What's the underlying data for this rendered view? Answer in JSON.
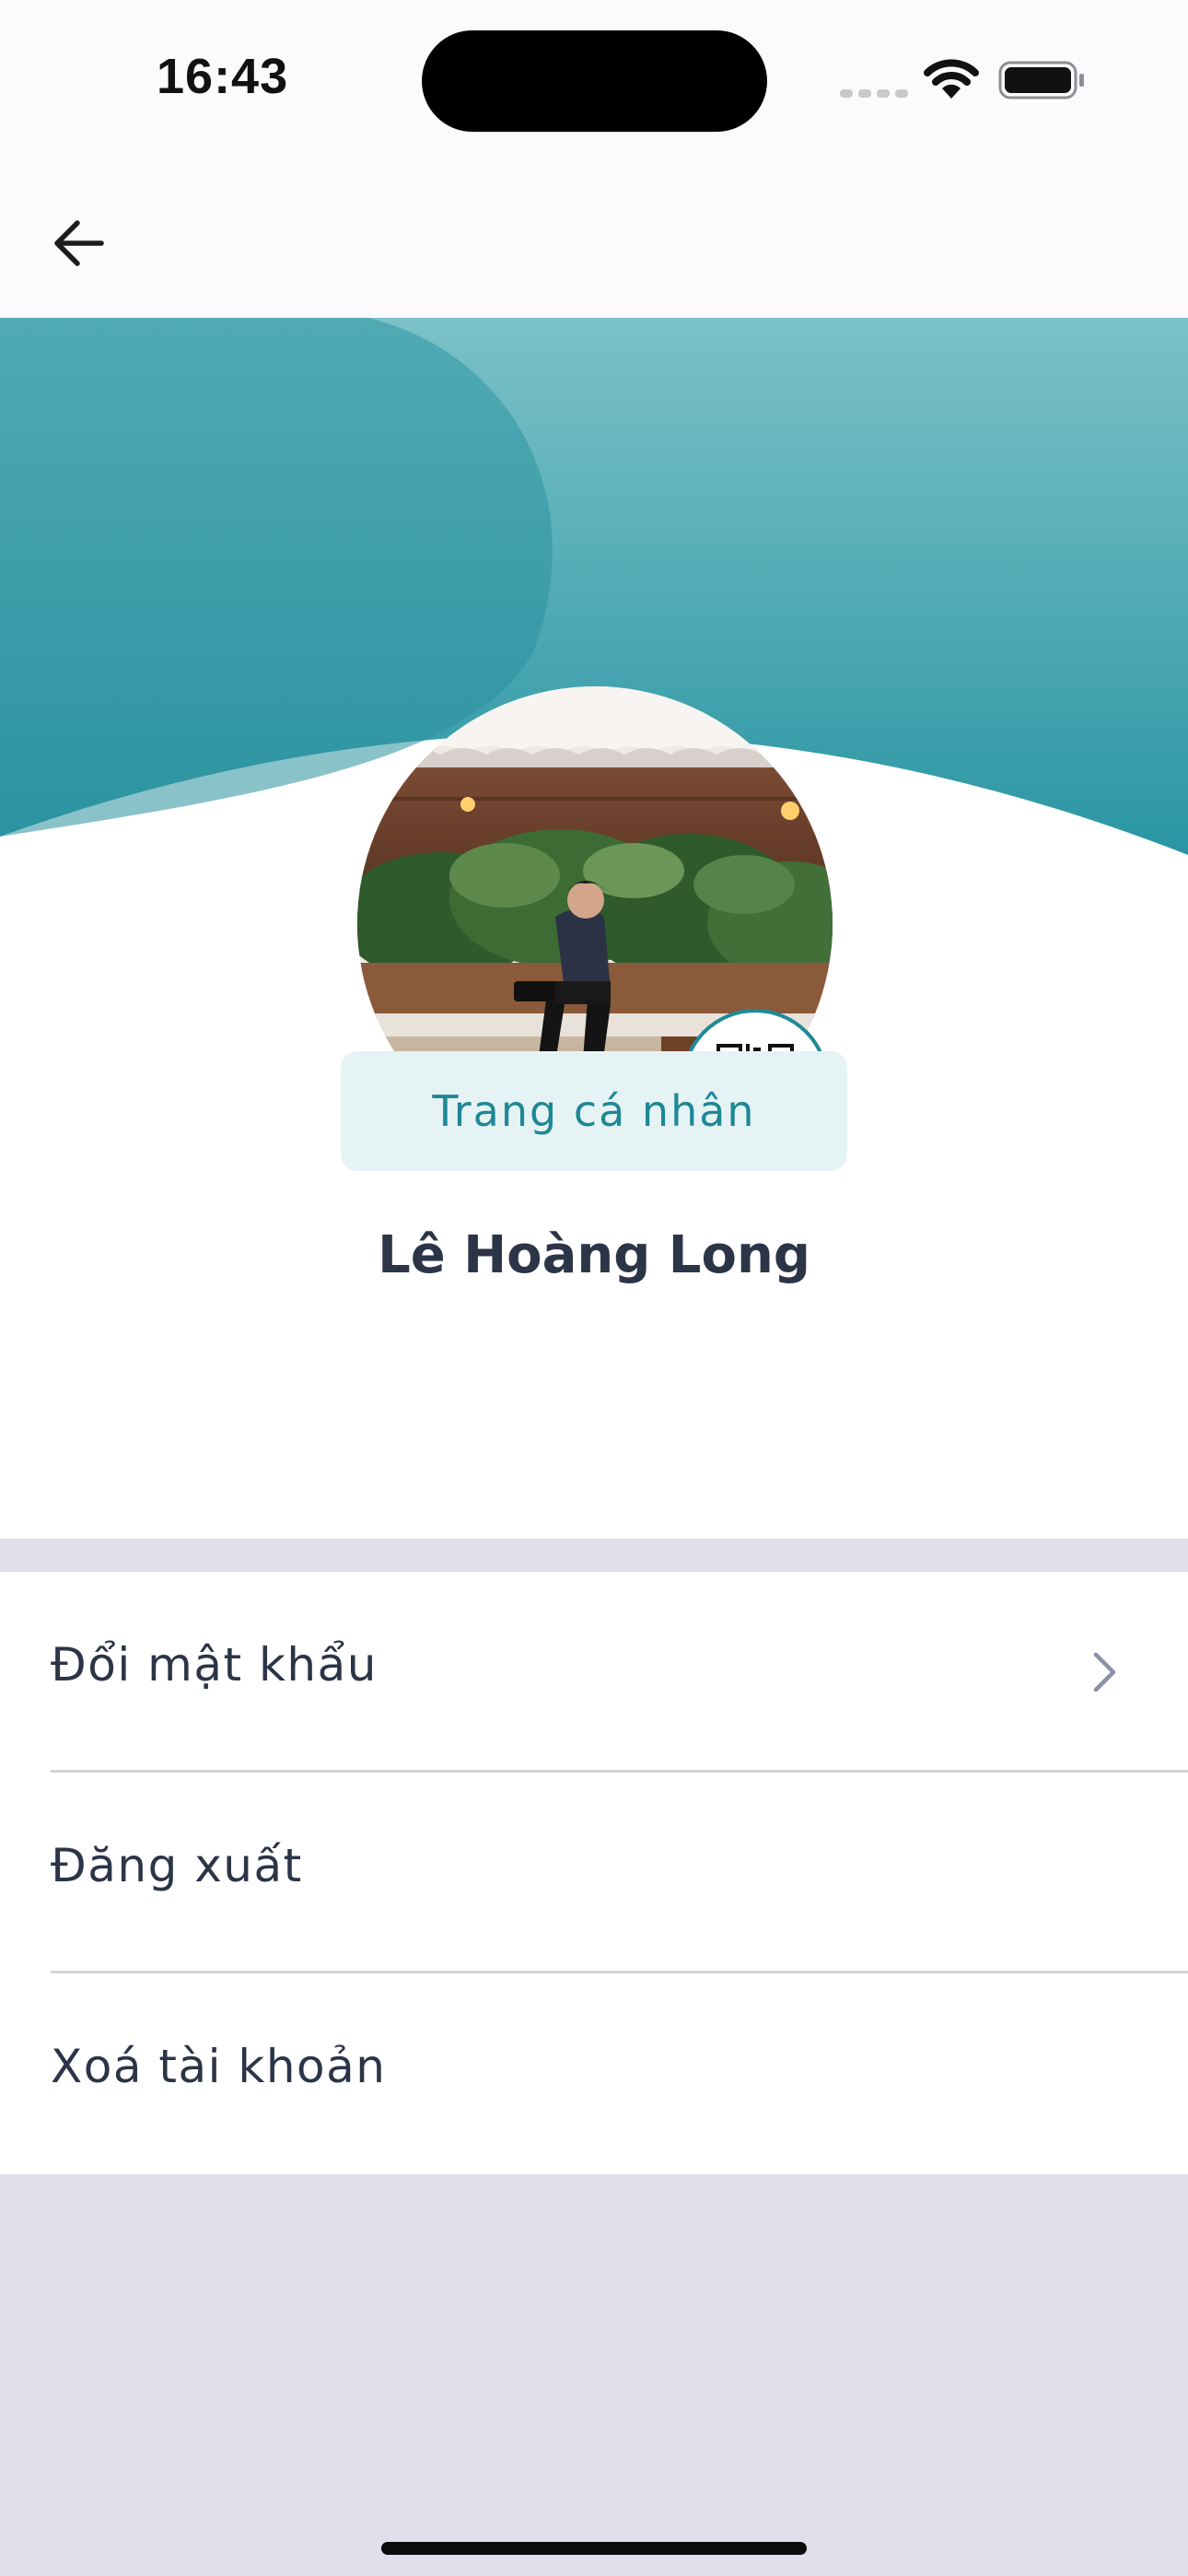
{
  "status_bar": {
    "time": "16:43"
  },
  "nav": {
    "back_icon": "arrow-left-icon"
  },
  "profile": {
    "name": "Lê Hoàng Long",
    "profile_button": "Trang cá nhân",
    "qr_icon": "qr-code-icon"
  },
  "menu": {
    "items": [
      {
        "label": "Đổi mật khẩu",
        "icon": "chevron-right-icon"
      },
      {
        "label": "Đăng xuất"
      },
      {
        "label": "Xoá tài khoản"
      }
    ]
  },
  "colors": {
    "accent": "#1e8795",
    "banner_top": "#7cc1c8",
    "banner_bottom": "#2a96a3",
    "page_background": "#dfe0ec",
    "button_background": "#e5f3f4",
    "text_primary": "#2c3447"
  }
}
